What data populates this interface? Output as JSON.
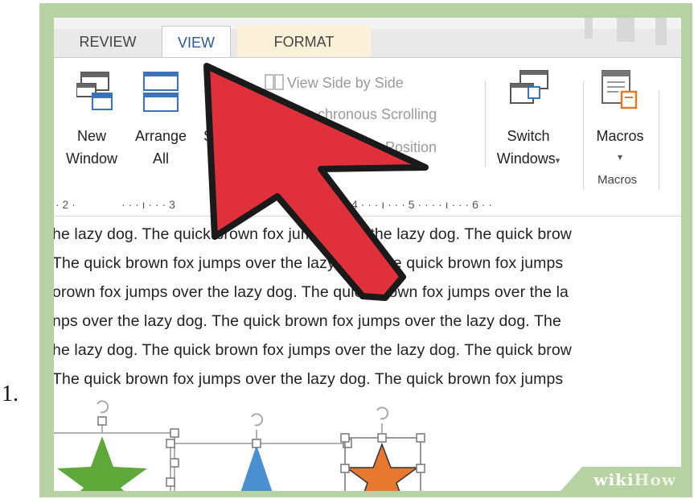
{
  "step": {
    "number": "1."
  },
  "tabs": [
    {
      "label": "REVIEW",
      "active": false
    },
    {
      "label": "VIEW",
      "active": true
    },
    {
      "label": "FORMAT",
      "active": false
    }
  ],
  "ribbon": {
    "new_window": {
      "line1": "New",
      "line2": "Window"
    },
    "arrange_all": {
      "line1": "Arrange",
      "line2": "All"
    },
    "split_partial": "S",
    "view_side_by_side": "View Side by Side",
    "synchronous_scrolling": "chronous Scrolling",
    "reset_window_position": "ow Position",
    "switch_windows": {
      "line1": "Switch",
      "line2": "Windows"
    },
    "macros": {
      "line1": "Macros",
      "caret": "▾"
    },
    "macros_group_label": "Macros",
    "dropdown_caret": "▾"
  },
  "ruler": {
    "marks": [
      "· 2 ·",
      "· · · ı · · · 3",
      "4 · · · ı · · · 5 · · · · ı · · · 6 · ·"
    ]
  },
  "document": {
    "lines": [
      "he lazy dog. The quick brown fox jumps over the lazy dog. The quick brow",
      "The quick brown fox jumps over the lazy dog. The quick brown fox jumps",
      "orown fox jumps over the lazy dog. The quick brown fox jumps over the la",
      "nps over the lazy dog.  The quick brown fox jumps over the lazy dog. The",
      "he lazy dog. The quick brown fox jumps over the lazy dog. The quick brow",
      "The quick brown fox jumps over the lazy dog. The quick brown fox jumps"
    ]
  },
  "shapes": [
    {
      "name": "green-star",
      "color": "#5fa83a"
    },
    {
      "name": "blue-triangle",
      "color": "#4a90d0"
    },
    {
      "name": "orange-star",
      "color": "#e8782e"
    }
  ],
  "arrow": {
    "color": "#e0303c",
    "outline": "#1a1a1a"
  },
  "watermark": {
    "wiki": "wiki",
    "how": "How"
  },
  "colors": {
    "frame": "#b7d3a3",
    "active_tab_text": "#2b5797",
    "format_tab_bg": "#fbf1d8"
  }
}
